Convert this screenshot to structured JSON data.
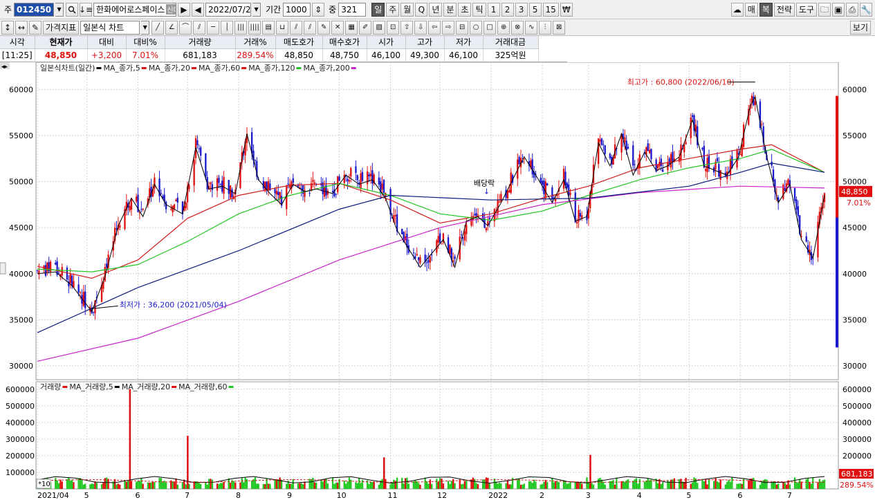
{
  "toolbar": {
    "code_label": "주",
    "code": "012450",
    "name": "한화에어로스페이스",
    "badge": "신대30",
    "date": "2022/07/22",
    "period_label": "기간",
    "period": "1000",
    "count_label": "중",
    "count": "321",
    "periods": [
      "일",
      "주",
      "월",
      "Q",
      "년",
      "분",
      "초",
      "틱",
      "1",
      "2",
      "3",
      "5",
      "15"
    ],
    "active_period": "일",
    "right_buttons": [
      "매",
      "복",
      "전략",
      "도구"
    ],
    "view_button": "보기"
  },
  "toolbar2": {
    "indicator_button": "가격지표",
    "chart_type": "일본식 차트"
  },
  "quote": {
    "headers": [
      "시각",
      "현재가",
      "대비",
      "대비%",
      "거래량",
      "거래%",
      "매도호가",
      "매수호가",
      "시가",
      "고가",
      "저가",
      "거래대금"
    ],
    "values": [
      "[11:25]",
      "48,850",
      "+3,200",
      "7.01%",
      "681,183",
      "289.54%",
      "48,850",
      "48,750",
      "46,100",
      "49,300",
      "46,100",
      "325억원"
    ]
  },
  "colors": {
    "up": "#e01010",
    "down": "#1a1acc",
    "ma5": "#e01010",
    "ma20": "#000000",
    "ma60": "#d01c1c",
    "ma120": "#21c721",
    "ma200": "#cc22cc",
    "ma_long": "#0a1a7a"
  },
  "chart_data": {
    "type": "candlestick",
    "price_legend": "일본식차트(일간) ▪ MA_종가,5 ▪ MA_종가,20 ▪ MA_종가,60 ▪ MA_종가,120 ▪ MA_종가,200",
    "legend_items": [
      {
        "label": "일본식차트(일간)",
        "color": "#000000"
      },
      {
        "label": "MA_종가,5",
        "color": "#e01010"
      },
      {
        "label": "MA_종가,20",
        "color": "#e01010"
      },
      {
        "label": "MA_종가,60",
        "color": "#e01010"
      },
      {
        "label": "MA_종가,120",
        "color": "#21c721"
      },
      {
        "label": "MA_종가,200",
        "color": "#cc22cc"
      }
    ],
    "volume_legend": [
      {
        "label": "거래량",
        "color": "#e01010"
      },
      {
        "label": "MA_거래량,5",
        "color": "#000000"
      },
      {
        "label": "MA_거래량,20",
        "color": "#e01010"
      },
      {
        "label": "MA_거래량,60",
        "color": "#21c721"
      }
    ],
    "price_ticks": [
      30000,
      35000,
      40000,
      45000,
      50000,
      55000,
      60000
    ],
    "price_tick_labels": [
      "30000",
      "35000",
      "40000",
      "45000",
      "50000",
      "55000",
      "60000"
    ],
    "price_ylim": [
      28500,
      62500
    ],
    "volume_ticks": [
      100000,
      200000,
      300000,
      400000,
      500000,
      600000
    ],
    "volume_tick_labels": [
      "100000",
      "200000",
      "300000",
      "400000",
      "500000",
      "600000"
    ],
    "volume_ylim": [
      0,
      620000
    ],
    "volume_unit_label": "*10",
    "x_labels": [
      "2021/04",
      "5",
      "6",
      "7",
      "8",
      "9",
      "10",
      "11",
      "12",
      "2022",
      "2",
      "3",
      "4",
      "5",
      "6",
      "7"
    ],
    "x_label_months": [
      "2021-04",
      "2021-05",
      "2021-06",
      "2021-07",
      "2021-08",
      "2021-09",
      "2021-10",
      "2021-11",
      "2021-12",
      "2022-01",
      "2022-02",
      "2022-03",
      "2022-04",
      "2022-05",
      "2022-06",
      "2022-07"
    ],
    "close_path": [
      [
        "2021-04-01",
        40300
      ],
      [
        "2021-04-12",
        40500
      ],
      [
        "2021-04-22",
        39000
      ],
      [
        "2021-05-04",
        36200
      ],
      [
        "2021-05-12",
        40000
      ],
      [
        "2021-05-20",
        45500
      ],
      [
        "2021-05-28",
        48500
      ],
      [
        "2021-06-04",
        46500
      ],
      [
        "2021-06-11",
        50000
      ],
      [
        "2021-06-18",
        47800
      ],
      [
        "2021-06-28",
        46800
      ],
      [
        "2021-07-06",
        54000
      ],
      [
        "2021-07-14",
        49500
      ],
      [
        "2021-07-22",
        49800
      ],
      [
        "2021-07-30",
        49000
      ],
      [
        "2021-08-06",
        55500
      ],
      [
        "2021-08-13",
        50500
      ],
      [
        "2021-08-20",
        49000
      ],
      [
        "2021-08-27",
        47800
      ],
      [
        "2021-09-03",
        50000
      ],
      [
        "2021-09-10",
        49200
      ],
      [
        "2021-09-17",
        49500
      ],
      [
        "2021-09-27",
        49000
      ],
      [
        "2021-10-05",
        51000
      ],
      [
        "2021-10-13",
        50000
      ],
      [
        "2021-10-21",
        50500
      ],
      [
        "2021-10-29",
        48500
      ],
      [
        "2021-11-05",
        45000
      ],
      [
        "2021-11-12",
        43000
      ],
      [
        "2021-11-19",
        41000
      ],
      [
        "2021-11-26",
        42500
      ],
      [
        "2021-12-03",
        44000
      ],
      [
        "2021-12-10",
        41000
      ],
      [
        "2021-12-17",
        46000
      ],
      [
        "2021-12-24",
        46500
      ],
      [
        "2021-12-30",
        45500
      ],
      [
        "2022-01-07",
        48000
      ],
      [
        "2022-01-14",
        50500
      ],
      [
        "2022-01-21",
        53000
      ],
      [
        "2022-01-28",
        51000
      ],
      [
        "2022-02-07",
        48000
      ],
      [
        "2022-02-14",
        50500
      ],
      [
        "2022-02-21",
        46000
      ],
      [
        "2022-02-28",
        46500
      ],
      [
        "2022-03-07",
        54500
      ],
      [
        "2022-03-14",
        52000
      ],
      [
        "2022-03-21",
        55500
      ],
      [
        "2022-03-28",
        51000
      ],
      [
        "2022-04-04",
        53500
      ],
      [
        "2022-04-11",
        51500
      ],
      [
        "2022-04-18",
        52000
      ],
      [
        "2022-04-25",
        53000
      ],
      [
        "2022-05-03",
        57000
      ],
      [
        "2022-05-10",
        52000
      ],
      [
        "2022-05-17",
        51500
      ],
      [
        "2022-05-24",
        51000
      ],
      [
        "2022-05-31",
        53000
      ],
      [
        "2022-06-07",
        58500
      ],
      [
        "2022-06-10",
        59500
      ],
      [
        "2022-06-17",
        53000
      ],
      [
        "2022-06-24",
        48000
      ],
      [
        "2022-07-01",
        50000
      ],
      [
        "2022-07-08",
        44000
      ],
      [
        "2022-07-15",
        42000
      ],
      [
        "2022-07-22",
        48850
      ]
    ],
    "series": [
      {
        "name": "MA_종가,60",
        "points": [
          [
            "2021-04-01",
            40800
          ],
          [
            "2021-05-04",
            39500
          ],
          [
            "2021-06-01",
            41500
          ],
          [
            "2021-07-01",
            46000
          ],
          [
            "2021-08-01",
            48500
          ],
          [
            "2021-09-01",
            49600
          ],
          [
            "2021-10-01",
            49800
          ],
          [
            "2021-11-01",
            48000
          ],
          [
            "2021-12-01",
            45500
          ],
          [
            "2022-01-01",
            46500
          ],
          [
            "2022-02-01",
            48200
          ],
          [
            "2022-03-01",
            49500
          ],
          [
            "2022-04-01",
            51500
          ],
          [
            "2022-05-01",
            52500
          ],
          [
            "2022-06-01",
            53500
          ],
          [
            "2022-06-20",
            54000
          ],
          [
            "2022-07-22",
            51000
          ]
        ]
      },
      {
        "name": "MA_종가,120",
        "points": [
          [
            "2021-04-01",
            40500
          ],
          [
            "2021-05-04",
            40200
          ],
          [
            "2021-06-01",
            41000
          ],
          [
            "2021-07-01",
            43500
          ],
          [
            "2021-08-01",
            46500
          ],
          [
            "2021-09-01",
            48500
          ],
          [
            "2021-10-01",
            49800
          ],
          [
            "2021-11-01",
            48500
          ],
          [
            "2021-12-01",
            46500
          ],
          [
            "2022-01-01",
            45800
          ],
          [
            "2022-02-01",
            46800
          ],
          [
            "2022-03-01",
            48500
          ],
          [
            "2022-04-01",
            50200
          ],
          [
            "2022-05-01",
            51500
          ],
          [
            "2022-06-01",
            52500
          ],
          [
            "2022-06-20",
            53500
          ],
          [
            "2022-07-22",
            51000
          ]
        ]
      },
      {
        "name": "MA_종가,200",
        "points": [
          [
            "2021-04-01",
            30500
          ],
          [
            "2021-06-01",
            33000
          ],
          [
            "2021-08-01",
            37000
          ],
          [
            "2021-10-01",
            41500
          ],
          [
            "2021-12-01",
            45000
          ],
          [
            "2022-02-01",
            47500
          ],
          [
            "2022-04-01",
            48800
          ],
          [
            "2022-06-01",
            49500
          ],
          [
            "2022-07-22",
            49300
          ]
        ]
      },
      {
        "name": "MA_종가,5",
        "points": [
          [
            "2021-04-01",
            33600
          ],
          [
            "2021-06-01",
            38500
          ],
          [
            "2021-08-01",
            42500
          ],
          [
            "2021-10-01",
            47000
          ],
          [
            "2021-11-01",
            48500
          ],
          [
            "2022-01-01",
            48000
          ],
          [
            "2022-03-01",
            48200
          ],
          [
            "2022-05-01",
            49500
          ],
          [
            "2022-06-01",
            51000
          ],
          [
            "2022-06-20",
            52000
          ],
          [
            "2022-07-22",
            51000
          ]
        ]
      }
    ],
    "annotations": [
      {
        "text": "최고가 : 60,800 (2022/06/10)",
        "date": "2022-06-10",
        "value": 60800
      },
      {
        "text": "최저가 : 36,200 (2021/05/04)",
        "date": "2021-05-04",
        "value": 36200
      },
      {
        "text": "배당락",
        "date": "2021-12-29",
        "value": 48500
      }
    ],
    "last_price_label": "48,850",
    "last_change_label": "7.01%",
    "last_volume_label": "681,183",
    "last_volume_pct_label": "289.54%",
    "volume_spikes": [
      [
        "2021-05-27",
        600000
      ],
      [
        "2021-07-01",
        320000
      ],
      [
        "2021-10-28",
        190000
      ],
      [
        "2022-03-02",
        205000
      ]
    ]
  }
}
